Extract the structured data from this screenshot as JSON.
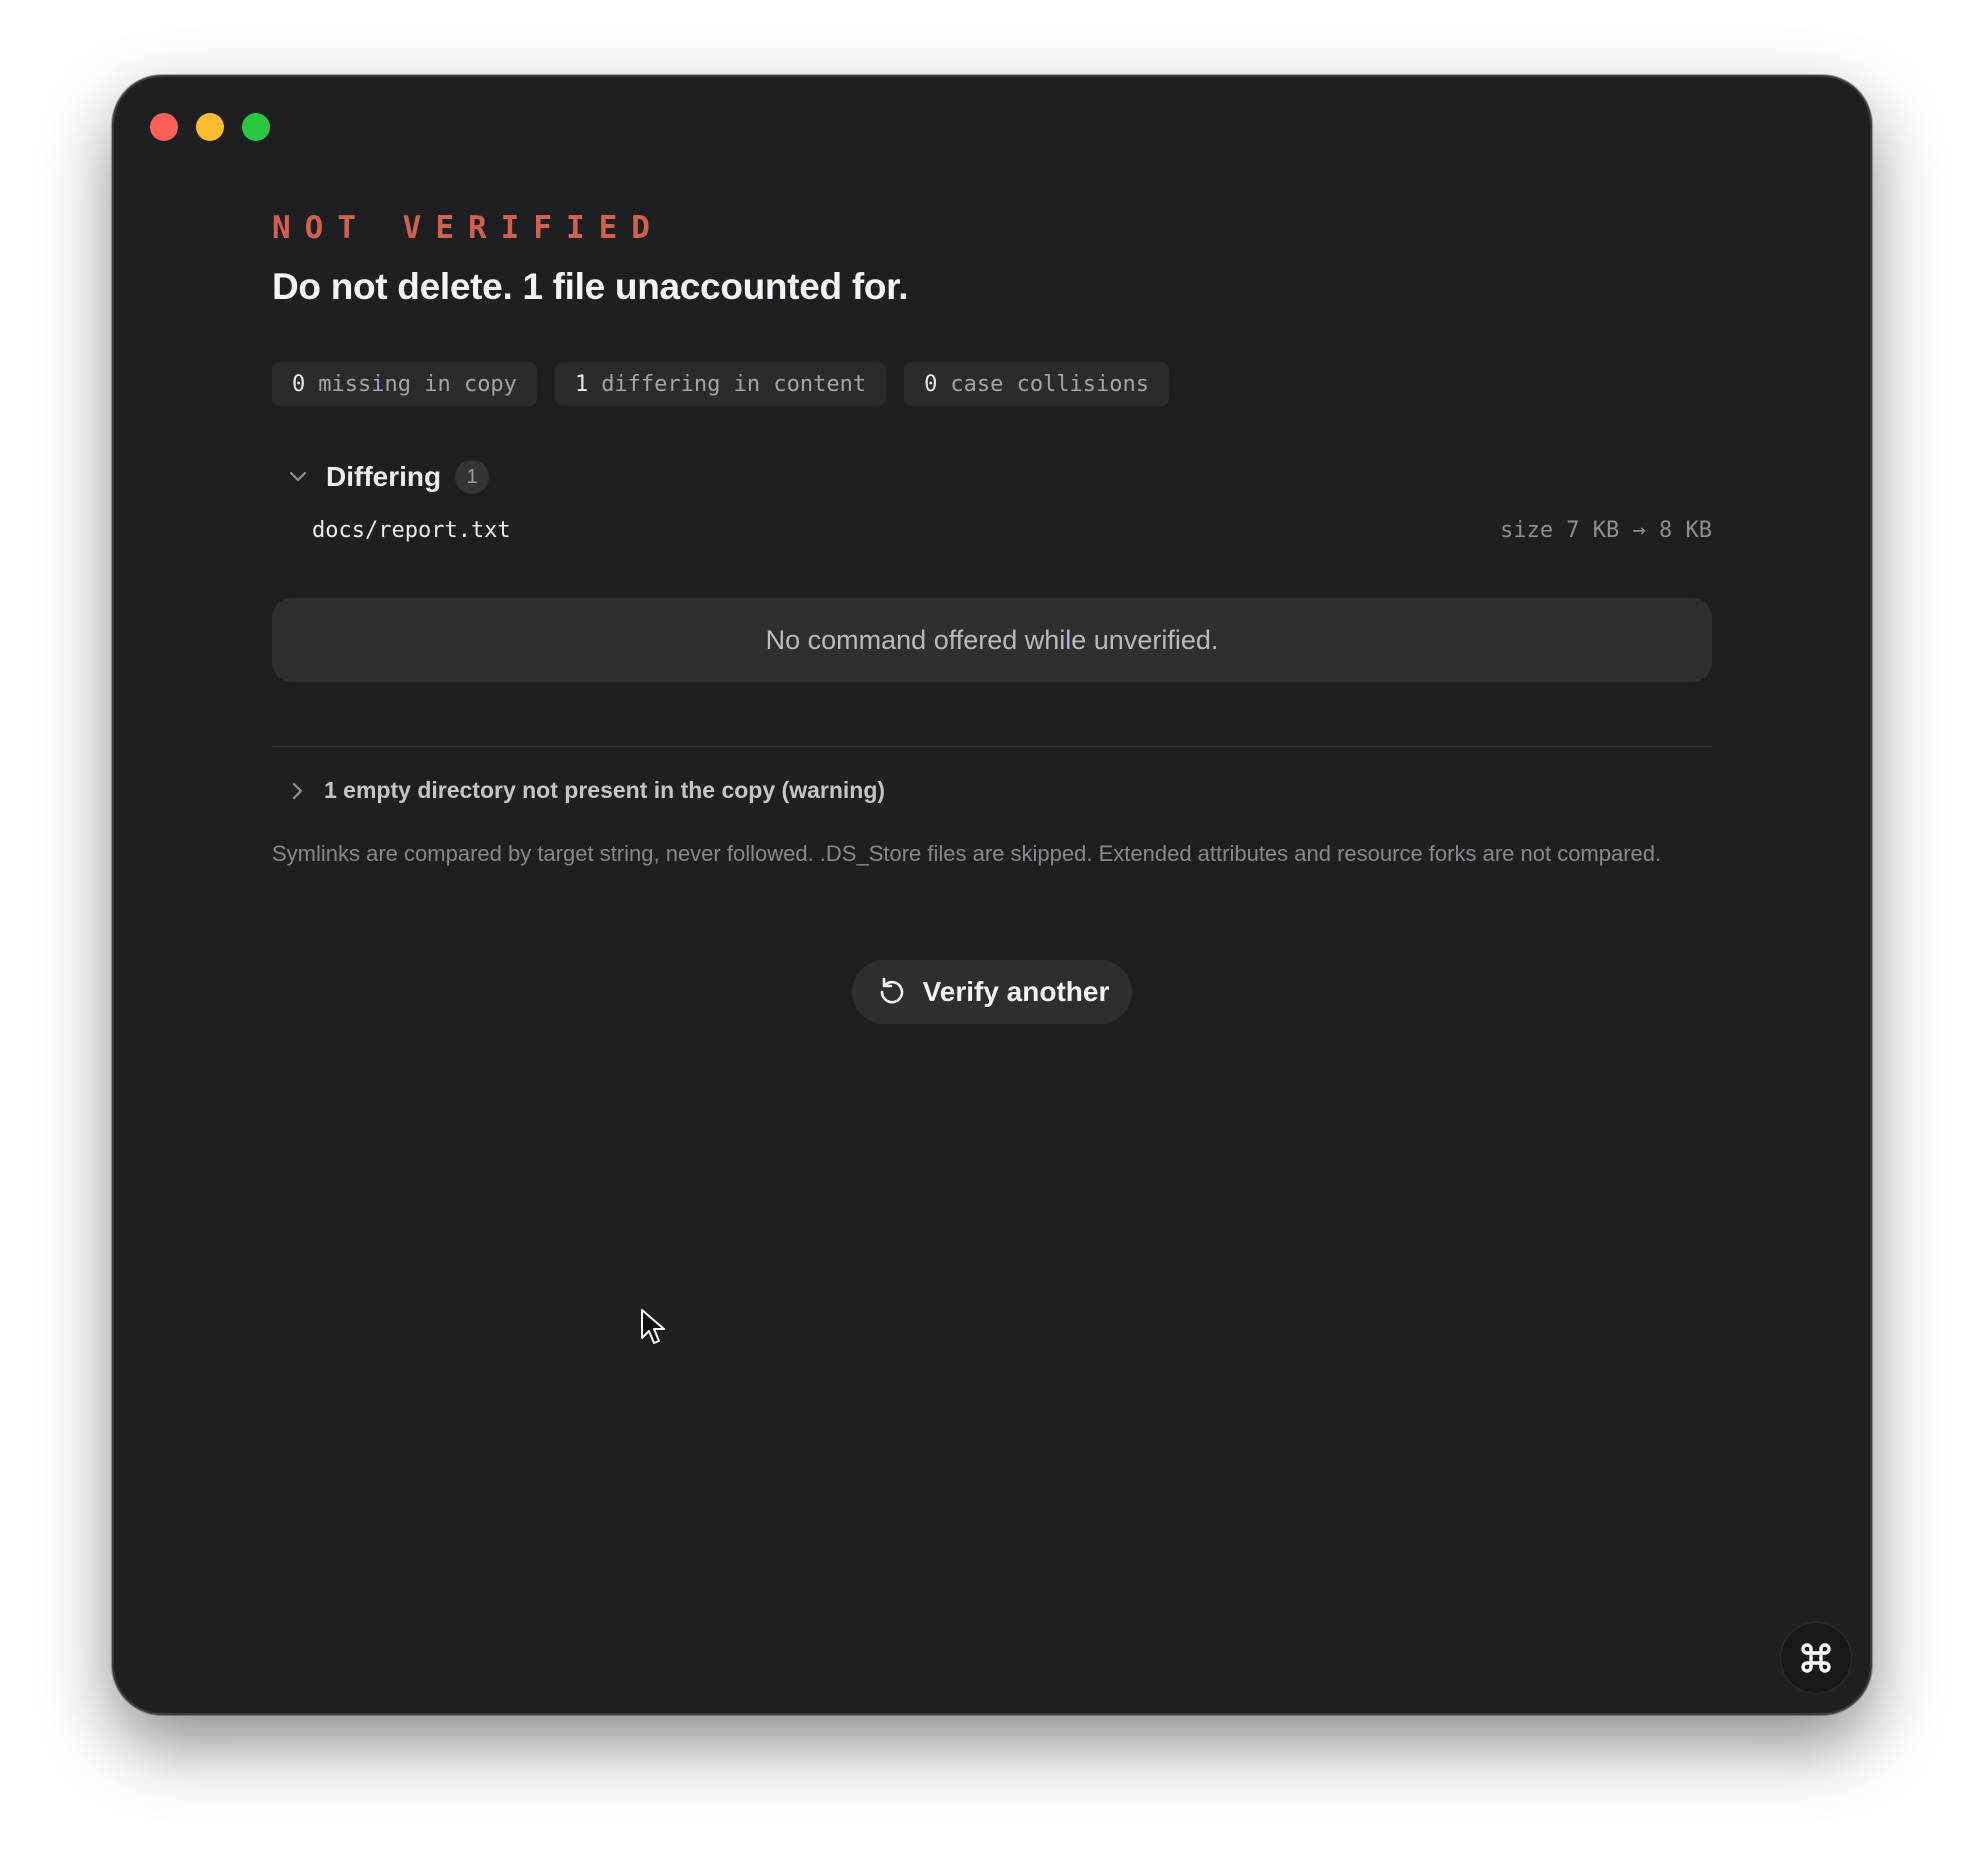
{
  "status": {
    "label": "NOT VERIFIED",
    "headline": "Do not delete. 1 file unaccounted for.",
    "color": "#d2604a"
  },
  "summary_chips": [
    {
      "count": "0",
      "label": "missing in copy"
    },
    {
      "count": "1",
      "label": "differing in content"
    },
    {
      "count": "0",
      "label": "case collisions"
    }
  ],
  "differing_section": {
    "title": "Differing",
    "count": "1",
    "expanded": true,
    "icon": "chevron-down-icon",
    "files": [
      {
        "path": "docs/report.txt",
        "detail": "size 7 KB → 8 KB"
      }
    ]
  },
  "notice": "No command offered while unverified.",
  "warning": {
    "text": "1 empty directory not present in the copy (warning)",
    "expanded": false,
    "icon": "chevron-right-icon"
  },
  "footnote": "Symlinks are compared by target string, never followed. .DS_Store files are skipped. Extended attributes and resource forks are not compared.",
  "actions": {
    "verify_another": "Verify another",
    "verify_icon": "refresh-icon",
    "corner_icon": "command-icon"
  },
  "colors": {
    "window_bg": "#1e1f22",
    "surface": "#2e2f33",
    "accent_error": "#d2604a"
  }
}
